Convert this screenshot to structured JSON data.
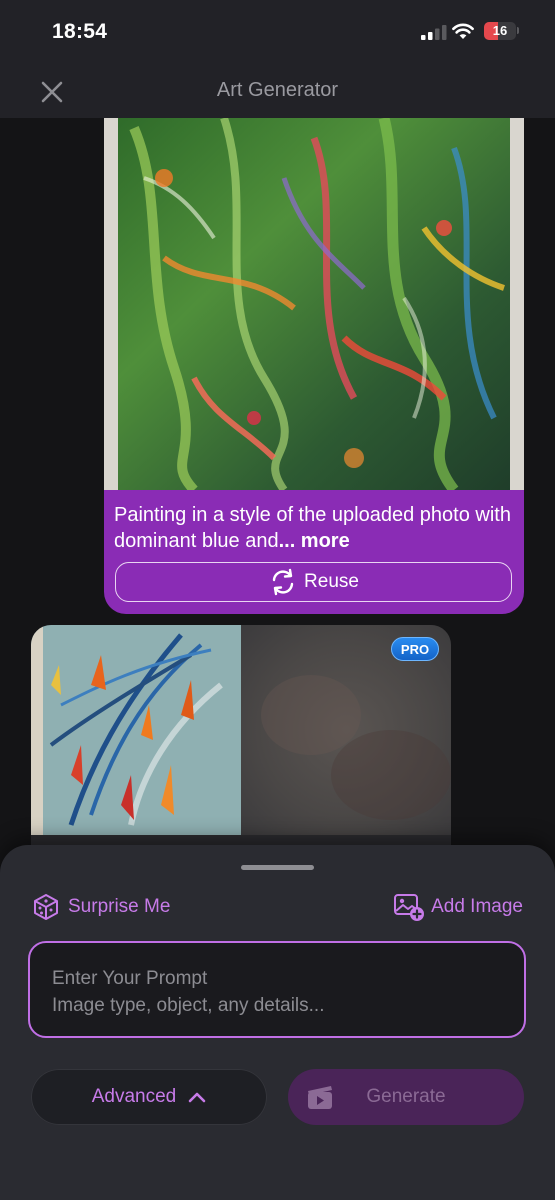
{
  "status_bar": {
    "time": "18:54",
    "battery": "16"
  },
  "header": {
    "title": "Art Generator",
    "close_icon": "close-icon"
  },
  "user_message": {
    "caption": "Painting in a style of the uploaded photo with dominant blue and",
    "more_label": "... more",
    "reuse_label": "Reuse"
  },
  "result": {
    "pro_badge": "PRO"
  },
  "bottom_sheet": {
    "surprise_label": "Surprise Me",
    "add_image_label": "Add Image",
    "prompt_placeholder_title": "Enter Your Prompt",
    "prompt_placeholder_hint": "Image type, object, any details...",
    "advanced_label": "Advanced",
    "generate_label": "Generate"
  },
  "colors": {
    "accent_purple": "#c77be9",
    "bubble_purple": "#8a2cb5",
    "pro_blue": "#1f7fe0"
  }
}
